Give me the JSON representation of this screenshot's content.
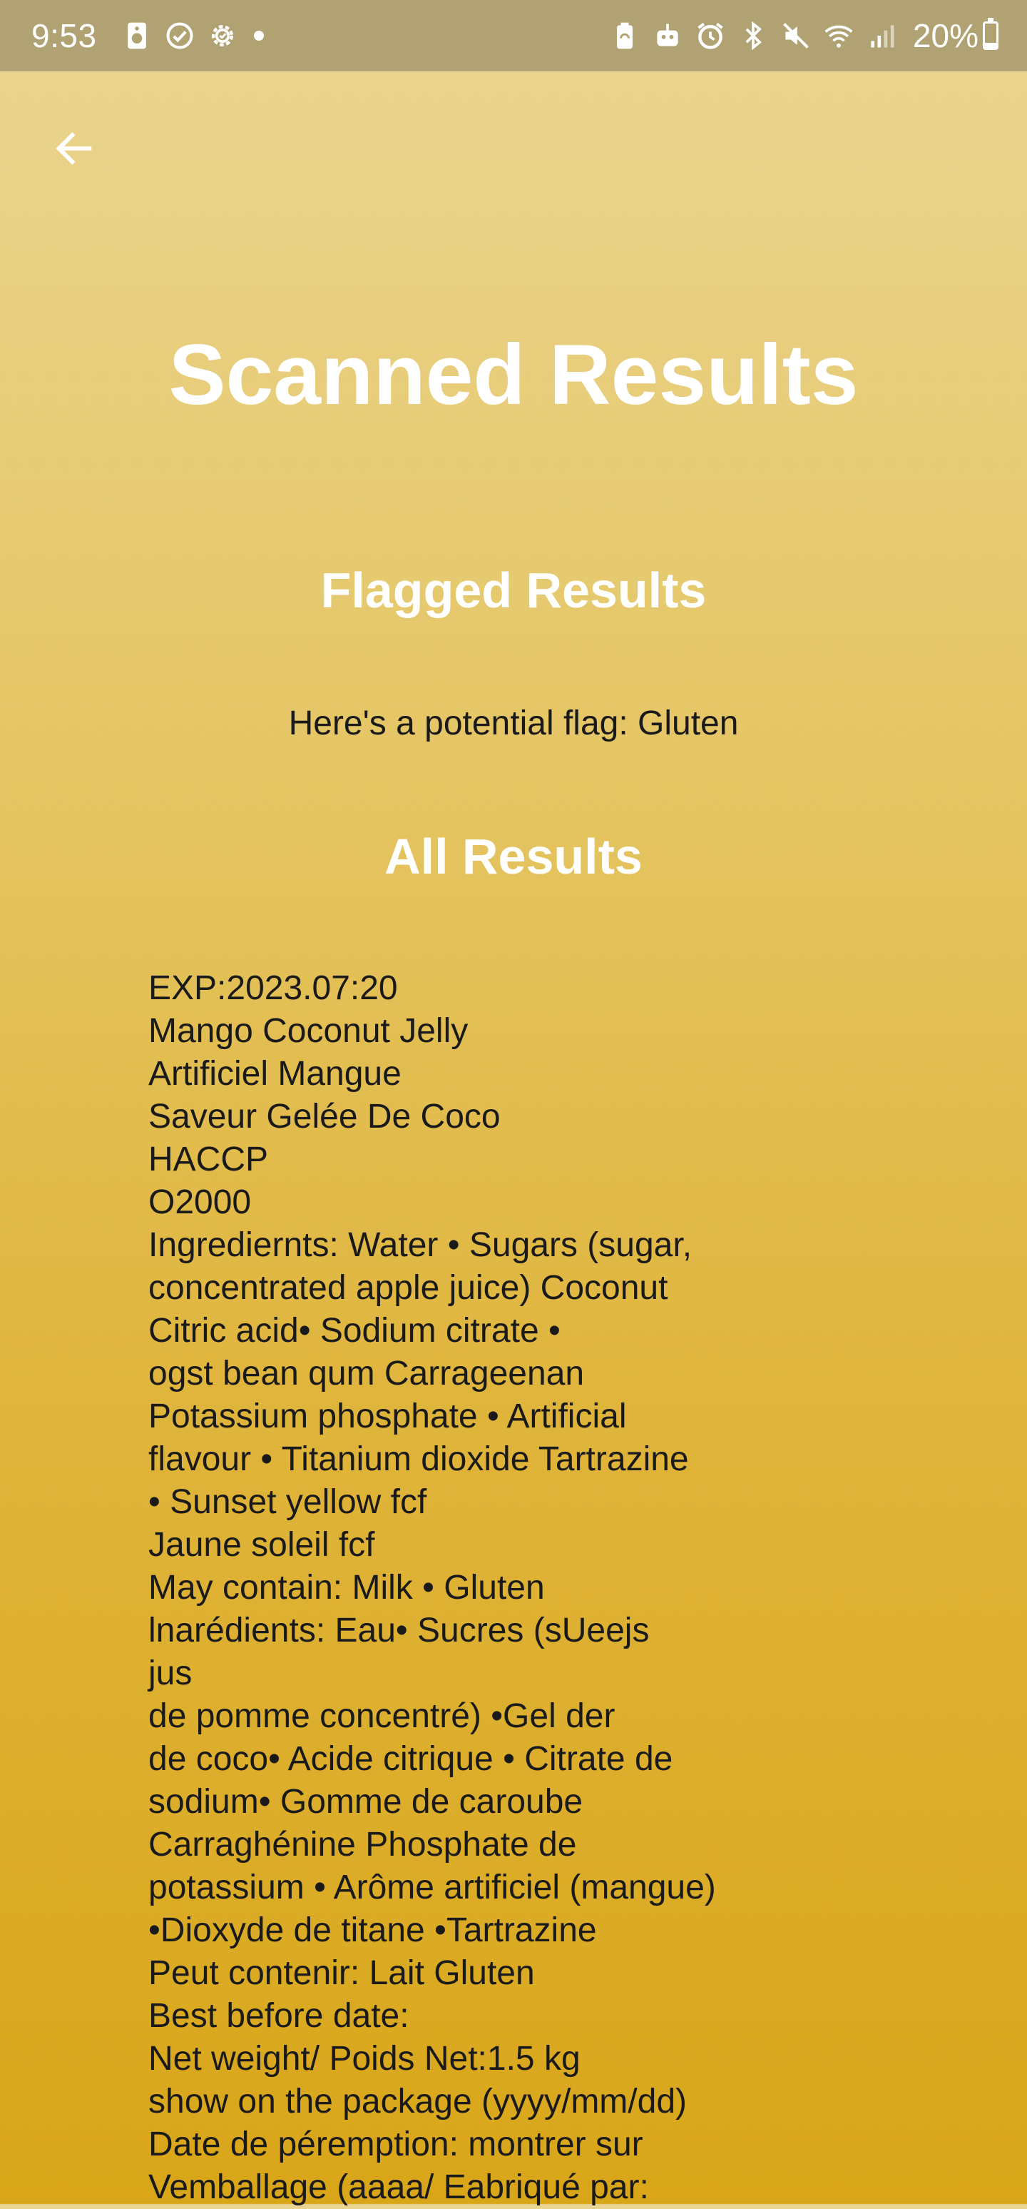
{
  "status_bar": {
    "time": "9:53",
    "battery_percent": "20%",
    "battery_level": 0.2,
    "left_icons": [
      "speaker-icon",
      "check-circle-icon",
      "settings-gear-icon",
      "notification-dot-icon"
    ],
    "right_icons": [
      "battery-saver-icon",
      "robot-icon",
      "alarm-icon",
      "bluetooth-icon",
      "mute-icon",
      "wifi-icon",
      "signal-icon"
    ]
  },
  "header": {
    "back_icon": "arrow-left-icon"
  },
  "page": {
    "title": "Scanned Results"
  },
  "flagged": {
    "title": "Flagged Results",
    "text": "Here's a potential flag: Gluten"
  },
  "all_results": {
    "title": "All Results",
    "lines": [
      "EXP:2023.07:20",
      "Mango Coconut Jelly",
      "Artificiel Mangue",
      "Saveur Gelée De Coco",
      "HACCP",
      "O2000",
      "Ingrediernts: Water • Sugars (sugar,",
      "concentrated apple juice) Coconut",
      "Citric acid• Sodium citrate •",
      "ogst bean qum Carrageenan",
      "Potassium phosphate • Artificial",
      "flavour • Titanium dioxide Tartrazine",
      "• Sunset yellow fcf",
      "Jaune soleil fcf",
      "May contain: Milk • Gluten",
      "lnarédients: Eau• Sucres (sUeejs",
      "jus",
      "de pomme concentré) •Gel der",
      "de coco• Acide citrique • Citrate de",
      "sodium• Gomme de caroube",
      "Carraghénine Phosphate de",
      "potassium • Arôme artificiel (mangue)",
      "•Dioxyde de titane •Tartrazine",
      "Peut contenir: Lait Gluten",
      "Best before date:",
      "Net weight/ Poids Net:1.5 kg",
      "show on the package (yyyy/mm/dd)",
      "Date de péremption: montrer sur",
      "Vemballage (aaaa/ Eabriqué par:"
    ]
  },
  "colors": {
    "status_bar_bg": "#b0a273",
    "gradient_top": "#ead592",
    "gradient_bottom": "#d9a619",
    "heading_text": "#ffffff",
    "body_text": "#1a1a1a"
  }
}
